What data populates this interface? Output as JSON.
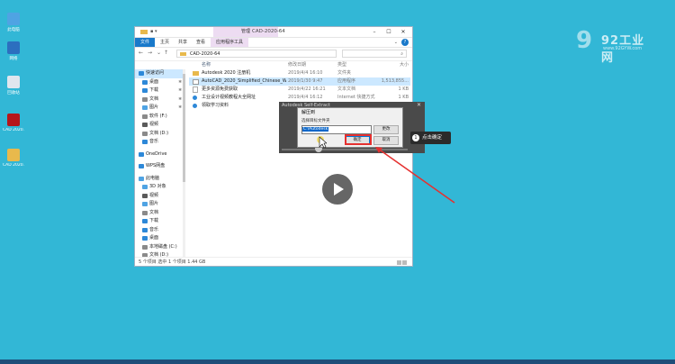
{
  "desktop": {
    "icons": [
      {
        "label": "此电脑",
        "color": "#4fa3e3"
      },
      {
        "label": "网络",
        "color": "#2c6fbf"
      },
      {
        "label": "回收站",
        "color": "#dfe6ee"
      },
      {
        "label": "CAD 2020...",
        "color": "#b5161b"
      },
      {
        "label": "CAD 2020...",
        "color": "#e8b94c"
      }
    ]
  },
  "logo": {
    "mark": "9",
    "brand": "92工业网",
    "url": "www.92GYW.com"
  },
  "explorer": {
    "title": "CAD-2020-64",
    "context_tab": "管理",
    "ribbon_tabs": [
      "文件",
      "主页",
      "共享",
      "查看",
      "应用程序工具"
    ],
    "address_path": "CAD-2020-64",
    "search_placeholder": "",
    "columns": {
      "name": "名称",
      "date": "修改日期",
      "type": "类型",
      "size": "大小"
    },
    "files": [
      {
        "name": "Autodesk 2020 注册机",
        "date": "2019/4/4 16:10",
        "type": "文件夹",
        "size": "",
        "icon": "folder",
        "selected": false
      },
      {
        "name": "AutoCAD_2020_Simplified_Chinese_Wi...",
        "date": "2019/1/30 9:47",
        "type": "应用程序",
        "size": "1,513,855...",
        "icon": "exe",
        "selected": true
      },
      {
        "name": "更多资源免费获取",
        "date": "2019/4/22 16:21",
        "type": "文本文档",
        "size": "1 KB",
        "icon": "txt",
        "selected": false
      },
      {
        "name": "工业设计视频教程大全网址",
        "date": "2019/4/4 16:12",
        "type": "Internet 快捷方式",
        "size": "1 KB",
        "icon": "link",
        "selected": false
      },
      {
        "name": "领取学习资料",
        "date": "2019/4/4 16:12",
        "type": "Internet 快捷方式",
        "size": "1 KB",
        "icon": "link",
        "selected": false
      }
    ],
    "sidebar": [
      {
        "label": "快速访问",
        "kind": "hdr",
        "color": "#2d88d8",
        "selected": true
      },
      {
        "label": "桌面",
        "kind": "item",
        "color": "#2d88d8",
        "pin": "✱"
      },
      {
        "label": "下载",
        "kind": "item",
        "color": "#2d88d8",
        "pin": "✱"
      },
      {
        "label": "文档",
        "kind": "item",
        "color": "#8a8a8a",
        "pin": "✱"
      },
      {
        "label": "图片",
        "kind": "item",
        "color": "#4fa3e3",
        "pin": "✱"
      },
      {
        "label": "软件 (F:)",
        "kind": "item",
        "color": "#8a8a8a",
        "pin": ""
      },
      {
        "label": "视频",
        "kind": "item",
        "color": "#5a5a5a",
        "pin": ""
      },
      {
        "label": "文档 (D:)",
        "kind": "item",
        "color": "#8a8a8a",
        "pin": ""
      },
      {
        "label": "音乐",
        "kind": "item",
        "color": "#2d88d8",
        "pin": ""
      },
      {
        "label": "OneDrive",
        "kind": "hdr",
        "color": "#2d88d8",
        "selected": false
      },
      {
        "label": "WPS网盘",
        "kind": "hdr",
        "color": "#2d88d8",
        "selected": false
      },
      {
        "label": "此电脑",
        "kind": "hdr",
        "color": "#4fa3e3",
        "selected": false
      },
      {
        "label": "3D 对象",
        "kind": "item",
        "color": "#4fa3e3",
        "pin": ""
      },
      {
        "label": "视频",
        "kind": "item",
        "color": "#5a5a5a",
        "pin": ""
      },
      {
        "label": "图片",
        "kind": "item",
        "color": "#4fa3e3",
        "pin": ""
      },
      {
        "label": "文档",
        "kind": "item",
        "color": "#8a8a8a",
        "pin": ""
      },
      {
        "label": "下载",
        "kind": "item",
        "color": "#2d88d8",
        "pin": ""
      },
      {
        "label": "音乐",
        "kind": "item",
        "color": "#2d88d8",
        "pin": ""
      },
      {
        "label": "桌面",
        "kind": "item",
        "color": "#2d88d8",
        "pin": ""
      },
      {
        "label": "本地磁盘 (C:)",
        "kind": "item",
        "color": "#8a8a8a",
        "pin": ""
      },
      {
        "label": "文档 (D:)",
        "kind": "item",
        "color": "#8a8a8a",
        "pin": ""
      }
    ],
    "status": "5 个项目   选中 1 个项目  1.44 GB"
  },
  "extract_panel": {
    "title": "Autodesk Self-Extract",
    "dialog_title": "解压到",
    "prompt": "选择目标文件夹",
    "path_value": "C:\\Autodesk",
    "browse_label": "更改",
    "ok_label": "确定",
    "cancel_label": "取消"
  },
  "callout": {
    "number": "1",
    "text": "点击确定"
  },
  "colors": {
    "desktop": "#32b7d6",
    "highlight": "#e5302f",
    "accent": "#1979ca"
  }
}
